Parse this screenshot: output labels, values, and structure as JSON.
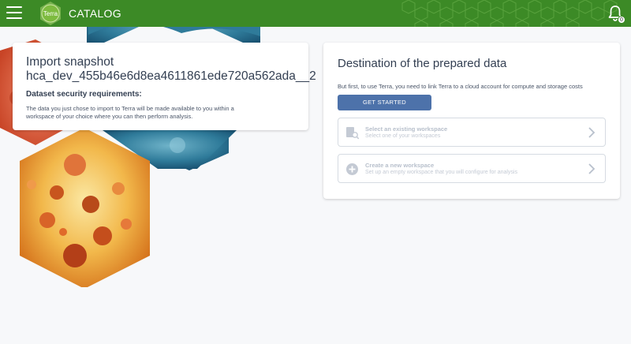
{
  "header": {
    "logo_text": "Terra",
    "app_title": "CATALOG",
    "notification_count": "0",
    "icons": [
      "menu-icon",
      "terra-logo",
      "bell-icon"
    ]
  },
  "snapshot": {
    "title_line1": "Import snapshot",
    "title_line2": "hca_dev_455b46e6d8ea4611861ede720a562ada__2",
    "security_heading": "Dataset security requirements:",
    "security_body": "The data you just chose to import to Terra will be made available to you within a workspace of your choice where you can then perform analysis."
  },
  "destination": {
    "heading": "Destination of the prepared data",
    "intro": "But first, to use Terra, you need to link Terra to a cloud account for compute and storage costs",
    "get_started_label": "GET STARTED",
    "options": [
      {
        "title": "Select an existing workspace",
        "subtitle": "Select one of your workspaces",
        "icon": "workspace-search-icon"
      },
      {
        "title": "Create a new workspace",
        "subtitle": "Set up an empty workspace that you will configure for analysis",
        "icon": "add-circle-icon"
      }
    ]
  },
  "colors": {
    "header_green": "#3c8a26",
    "button_blue": "#4d72aa",
    "text_dark": "#333f52",
    "disabled_text": "#b8c0cc"
  }
}
